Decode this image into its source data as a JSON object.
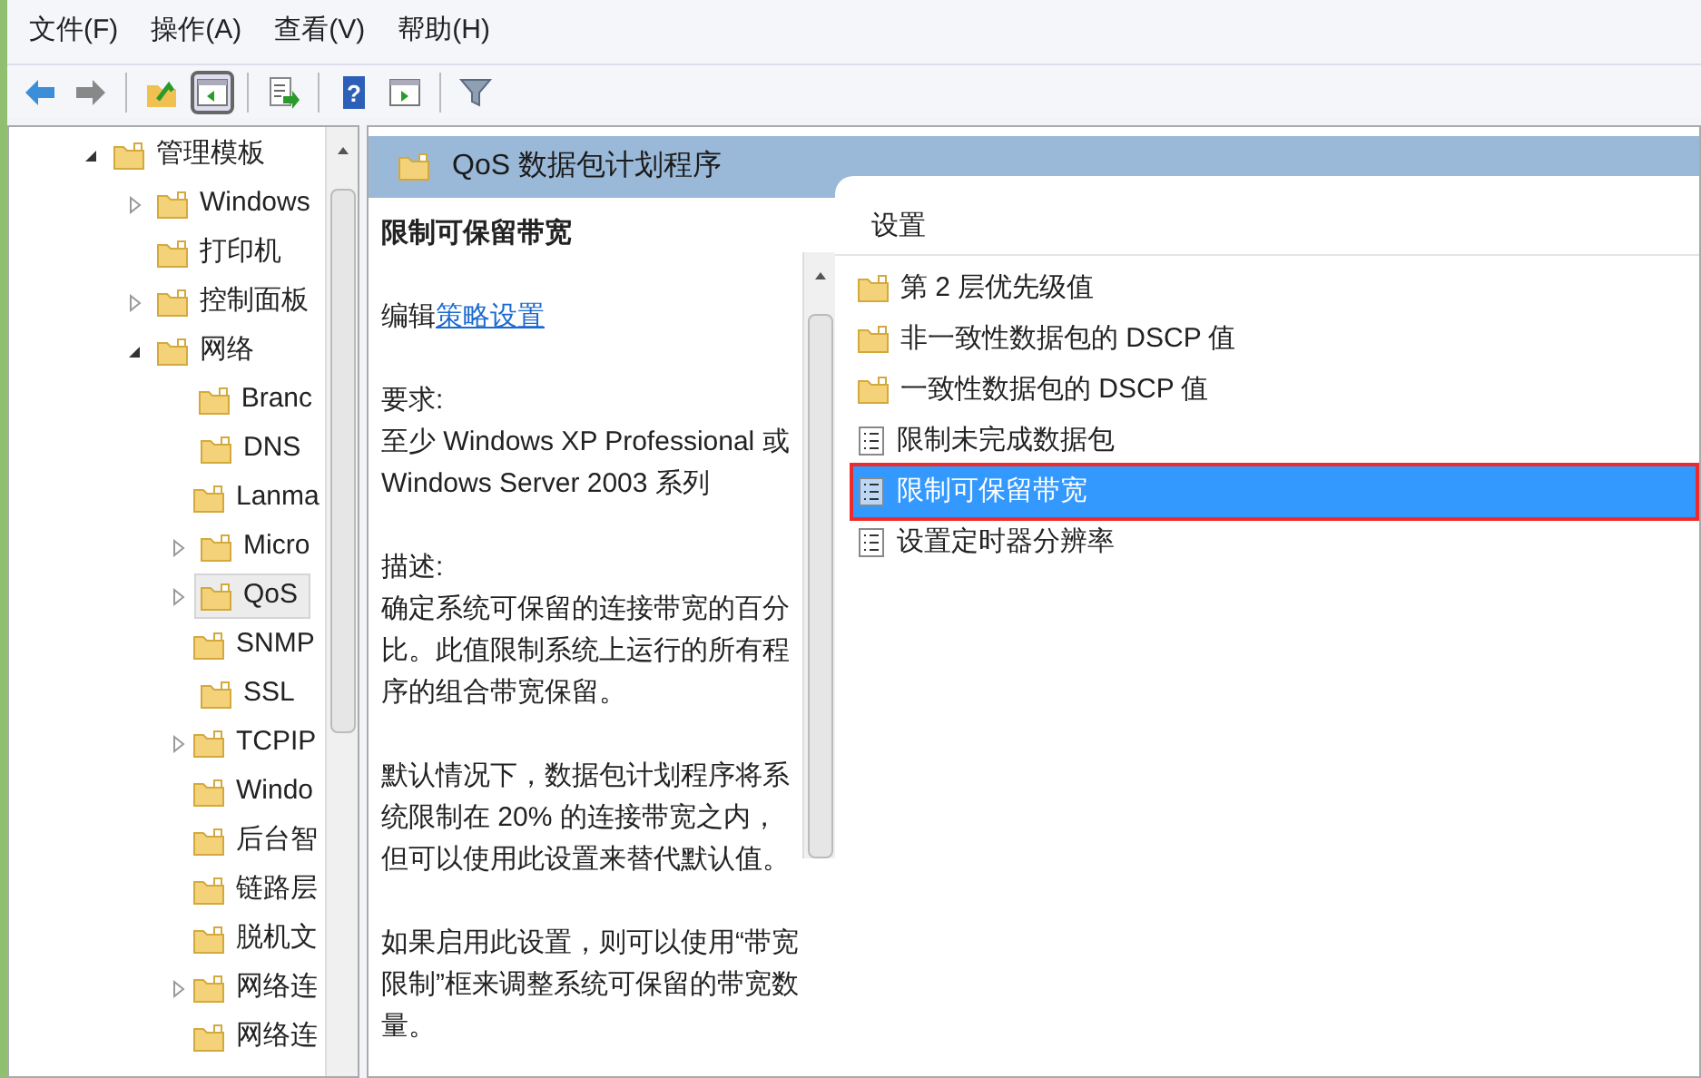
{
  "menu": [
    {
      "label": "文件(F)"
    },
    {
      "label": "操作(A)"
    },
    {
      "label": "查看(V)"
    },
    {
      "label": "帮助(H)"
    }
  ],
  "toolbar": [
    {
      "kind": "back"
    },
    {
      "kind": "forward"
    },
    {
      "kind": "sep"
    },
    {
      "kind": "up"
    },
    {
      "kind": "tree",
      "selected": true
    },
    {
      "kind": "sep"
    },
    {
      "kind": "export"
    },
    {
      "kind": "sep"
    },
    {
      "kind": "help",
      "label": "?"
    },
    {
      "kind": "pane",
      "selected": false
    },
    {
      "kind": "sep"
    },
    {
      "kind": "filter"
    }
  ],
  "tree": [
    {
      "label": "管理模板",
      "expandable": true,
      "expanded": true,
      "selected": false,
      "children": [
        {
          "label": "Windows",
          "expandable": true,
          "expanded": false,
          "selected": false
        },
        {
          "label": "打印机",
          "expandable": false,
          "selected": false
        },
        {
          "label": "控制面板",
          "expandable": true,
          "expanded": false,
          "selected": false
        },
        {
          "label": "网络",
          "expandable": true,
          "expanded": true,
          "selected": false,
          "children": [
            {
              "label": "Branc",
              "expandable": false,
              "selected": false
            },
            {
              "label": "DNS",
              "expandable": false,
              "selected": false
            },
            {
              "label": "Lanma",
              "expandable": false,
              "selected": false
            },
            {
              "label": "Micro",
              "expandable": true,
              "expanded": false,
              "selected": false
            },
            {
              "label": "QoS",
              "expandable": true,
              "expanded": false,
              "selected": true
            },
            {
              "label": "SNMP",
              "expandable": false,
              "selected": false
            },
            {
              "label": "SSL",
              "expandable": false,
              "selected": false
            },
            {
              "label": "TCPIP",
              "expandable": true,
              "expanded": false,
              "selected": false
            },
            {
              "label": "Windo",
              "expandable": false,
              "selected": false
            },
            {
              "label": "后台智",
              "expandable": false,
              "selected": false
            },
            {
              "label": "链路层",
              "expandable": false,
              "selected": false
            },
            {
              "label": "脱机文",
              "expandable": false,
              "selected": false
            },
            {
              "label": "网络连",
              "expandable": true,
              "expanded": false,
              "selected": false
            },
            {
              "label": "网络连",
              "expandable": false,
              "selected": false
            }
          ]
        }
      ]
    }
  ],
  "header": {
    "title": "QoS 数据包计划程序"
  },
  "detail": {
    "title": "限制可保留带宽",
    "edit_prefix": "编辑",
    "edit_link": "策略设置",
    "paragraphs": [
      {
        "label": "要求:",
        "text": "至少 Windows XP Professional 或 Windows Server 2003 系列"
      },
      {
        "label": "描述:",
        "text": "确定系统可保留的连接带宽的百分比。此值限制系统上运行的所有程序的组合带宽保留。"
      },
      {
        "text": "默认情况下，数据包计划程序将系统限制在 20% 的连接带宽之内，但可以使用此设置来替代默认值。"
      },
      {
        "text": "如果启用此设置，则可以使用“带宽限制”框来调整系统可保留的带宽数量。"
      }
    ]
  },
  "list": {
    "column": "设置",
    "items": [
      {
        "label": "第 2 层优先级值",
        "kind": "folder",
        "selected": false
      },
      {
        "label": "非一致性数据包的 DSCP 值",
        "kind": "folder",
        "selected": false
      },
      {
        "label": "一致性数据包的 DSCP 值",
        "kind": "folder",
        "selected": false
      },
      {
        "label": "限制未完成数据包",
        "kind": "setting",
        "selected": false
      },
      {
        "label": "限制可保留带宽",
        "kind": "setting",
        "selected": true
      },
      {
        "label": "设置定时器分辨率",
        "kind": "setting",
        "selected": false
      }
    ]
  }
}
